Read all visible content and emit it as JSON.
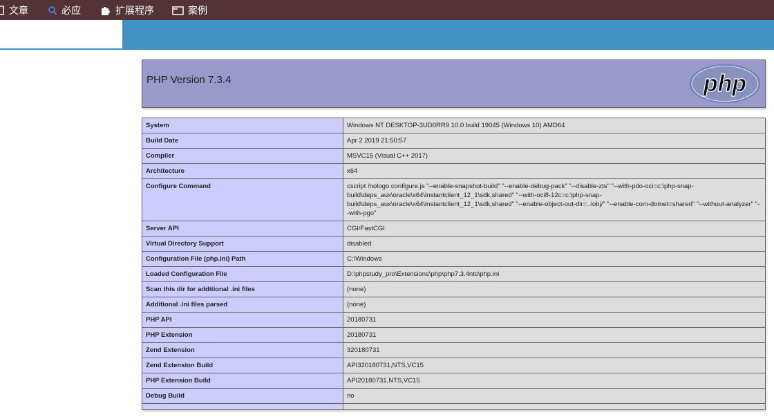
{
  "topbar": {
    "articles_label": "文章",
    "bing_label": "必应",
    "extensions_label": "扩展程序",
    "cases_label": "案例"
  },
  "icons": {
    "articles": "document-icon",
    "bing": "search-icon",
    "extensions": "puzzle-icon",
    "cases": "folder-icon"
  },
  "colors": {
    "topbar": "#533336",
    "band": "#4192c6",
    "header": "#9999cc",
    "key_cell": "#ccccff",
    "value_cell": "#dddddd"
  },
  "phpinfo": {
    "title": "PHP Version 7.3.4",
    "logo_text": "php",
    "rows": [
      {
        "key": "System",
        "value": "Windows NT DESKTOP-3UD0RR9 10.0 build 19045 (Windows 10) AMD64"
      },
      {
        "key": "Build Date",
        "value": "Apr 2 2019 21:50:57"
      },
      {
        "key": "Compiler",
        "value": "MSVC15 (Visual C++ 2017)"
      },
      {
        "key": "Architecture",
        "value": "x64"
      },
      {
        "key": "Configure Command",
        "value": "cscript /nologo configure.js \"--enable-snapshot-build\" \"--enable-debug-pack\" \"--disable-zts\" \"--with-pdo-oci=c:\\php-snap-build\\deps_aux\\oracle\\x64\\instantclient_12_1\\sdk,shared\" \"--with-oci8-12c=c:\\php-snap-build\\deps_aux\\oracle\\x64\\instantclient_12_1\\sdk,shared\" \"--enable-object-out-dir=../obj/\" \"--enable-com-dotnet=shared\" \"--without-analyzer\" \"--with-pgo\""
      },
      {
        "key": "Server API",
        "value": "CGI/FastCGI"
      },
      {
        "key": "Virtual Directory Support",
        "value": "disabled"
      },
      {
        "key": "Configuration File (php.ini) Path",
        "value": "C:\\Windows"
      },
      {
        "key": "Loaded Configuration File",
        "value": "D:\\phpstudy_pro\\Extensions\\php\\php7.3.4nts\\php.ini"
      },
      {
        "key": "Scan this dir for additional .ini files",
        "value": "(none)"
      },
      {
        "key": "Additional .ini files parsed",
        "value": "(none)"
      },
      {
        "key": "PHP API",
        "value": "20180731"
      },
      {
        "key": "PHP Extension",
        "value": "20180731"
      },
      {
        "key": "Zend Extension",
        "value": "320180731"
      },
      {
        "key": "Zend Extension Build",
        "value": "API320180731,NTS,VC15"
      },
      {
        "key": "PHP Extension Build",
        "value": "API20180731,NTS,VC15"
      },
      {
        "key": "Debug Build",
        "value": "no"
      },
      {
        "key": "",
        "value": ""
      }
    ]
  }
}
